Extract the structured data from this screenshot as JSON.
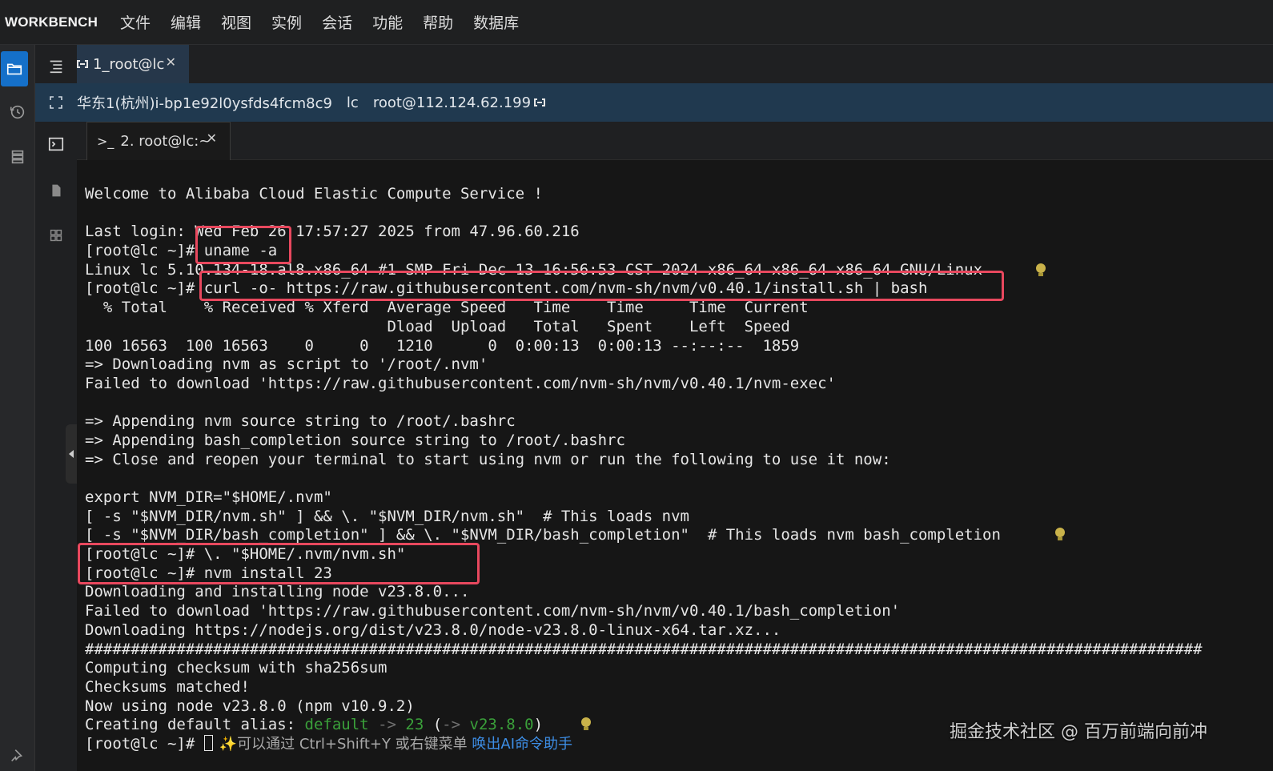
{
  "menubar": {
    "brand": "WORKBENCH",
    "items": [
      "文件",
      "编辑",
      "视图",
      "实例",
      "会话",
      "功能",
      "帮助",
      "数据库"
    ]
  },
  "session_tab": {
    "label": "1_root@lc"
  },
  "infobar": {
    "instance": "华东1(杭州)i-bp1e92l0ysfds4fcm8c9",
    "host": "lc",
    "login": "root@112.124.62.199"
  },
  "terminal_tab": {
    "prompt_icon": ">_",
    "label": "2. root@lc:~"
  },
  "terminal": {
    "lines": [
      "Welcome to Alibaba Cloud Elastic Compute Service !",
      "",
      "Last login: Wed Feb 26 17:57:27 2025 from 47.96.60.216",
      "[root@lc ~]# uname -a",
      "Linux lc 5.10.134-18.al8.x86_64 #1 SMP Fri Dec 13 16:56:53 CST 2024 x86_64 x86_64 x86_64 GNU/Linux",
      "[root@lc ~]# curl -o- https://raw.githubusercontent.com/nvm-sh/nvm/v0.40.1/install.sh | bash",
      "  % Total    % Received % Xferd  Average Speed   Time    Time     Time  Current",
      "                                 Dload  Upload   Total   Spent    Left  Speed",
      "100 16563  100 16563    0     0   1210      0  0:00:13  0:00:13 --:--:--  1859",
      "=> Downloading nvm as script to '/root/.nvm'",
      "Failed to download 'https://raw.githubusercontent.com/nvm-sh/nvm/v0.40.1/nvm-exec'",
      "",
      "=> Appending nvm source string to /root/.bashrc",
      "=> Appending bash_completion source string to /root/.bashrc",
      "=> Close and reopen your terminal to start using nvm or run the following to use it now:",
      "",
      "export NVM_DIR=\"$HOME/.nvm\"",
      "[ -s \"$NVM_DIR/nvm.sh\" ] && \\. \"$NVM_DIR/nvm.sh\"  # This loads nvm",
      "[ -s \"$NVM_DIR/bash_completion\" ] && \\. \"$NVM_DIR/bash_completion\"  # This loads nvm bash_completion",
      "[root@lc ~]# \\. \"$HOME/.nvm/nvm.sh\"",
      "[root@lc ~]# nvm install 23",
      "Downloading and installing node v23.8.0...",
      "Failed to download 'https://raw.githubusercontent.com/nvm-sh/nvm/v0.40.1/bash_completion'",
      "Downloading https://nodejs.org/dist/v23.8.0/node-v23.8.0-linux-x64.tar.xz...",
      "##########################################################################################################################",
      "Computing checksum with sha256sum",
      "Checksums matched!",
      "Now using node v23.8.0 (npm v10.9.2)"
    ],
    "alias_line": {
      "prefix": "Creating default alias: ",
      "name": "default",
      "arrow": " -> ",
      "version": "23",
      "paren_open": " (",
      "arrow2": "-> ",
      "resolved": "v23.8.0",
      "paren_close": ")"
    },
    "prompt_line": {
      "prompt": "[root@lc ~]# ",
      "hint_sparkle": "✨",
      "hint": "可以通过 Ctrl+Shift+Y 或右键菜单 ",
      "hint_link": "唤出AI命令助手"
    }
  },
  "watermark": "掘金技术社区 @ 百万前端向前冲",
  "colors": {
    "highlight_box": "#e8485e",
    "accent_blue": "#1570c9",
    "info_bar": "#20394f",
    "alias_green": "#3aa03a",
    "bulb": "#d8c04a"
  },
  "icons": {
    "activity": [
      "folder-icon",
      "history-icon",
      "server-list-icon"
    ],
    "panel": [
      "terminal-icon",
      "file-icon",
      "apps-grid-icon"
    ]
  }
}
